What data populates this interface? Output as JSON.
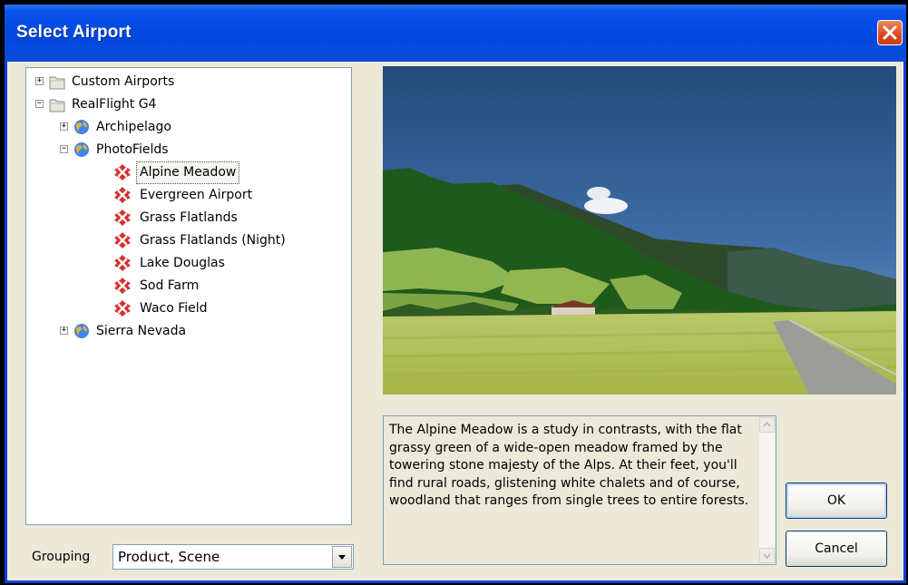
{
  "window": {
    "title": "Select Airport"
  },
  "tree": {
    "items": [
      {
        "label": "Custom Airports",
        "expander": "+",
        "icon": "folder-icon"
      },
      {
        "label": "RealFlight G4",
        "expander": "−",
        "icon": "folder-icon"
      },
      {
        "label": "Archipelago",
        "expander": "+",
        "icon": "globe-icon"
      },
      {
        "label": "PhotoFields",
        "expander": "−",
        "icon": "globe-icon"
      },
      {
        "label": "Alpine Meadow",
        "icon": "airport-icon",
        "selected": true
      },
      {
        "label": "Evergreen Airport",
        "icon": "airport-icon"
      },
      {
        "label": "Grass Flatlands",
        "icon": "airport-icon"
      },
      {
        "label": "Grass Flatlands (Night)",
        "icon": "airport-icon"
      },
      {
        "label": "Lake Douglas",
        "icon": "airport-icon"
      },
      {
        "label": "Sod Farm",
        "icon": "airport-icon"
      },
      {
        "label": "Waco Field",
        "icon": "airport-icon"
      },
      {
        "label": "Sierra Nevada",
        "expander": "+",
        "icon": "globe-icon"
      }
    ]
  },
  "grouping": {
    "label": "Grouping",
    "value": "Product, Scene"
  },
  "description": "The Alpine Meadow is a study in contrasts, with the flat grassy green of a wide-open meadow framed by the towering stone majesty of the Alps. At their feet, you'll find rural roads, glistening white chalets and of course, woodland that ranges from single trees to entire forests.",
  "buttons": {
    "ok": "OK",
    "cancel": "Cancel"
  },
  "colors": {
    "titlebar": "#0046e0",
    "dialog_bg": "#ece9d8",
    "close": "#d9481c"
  }
}
